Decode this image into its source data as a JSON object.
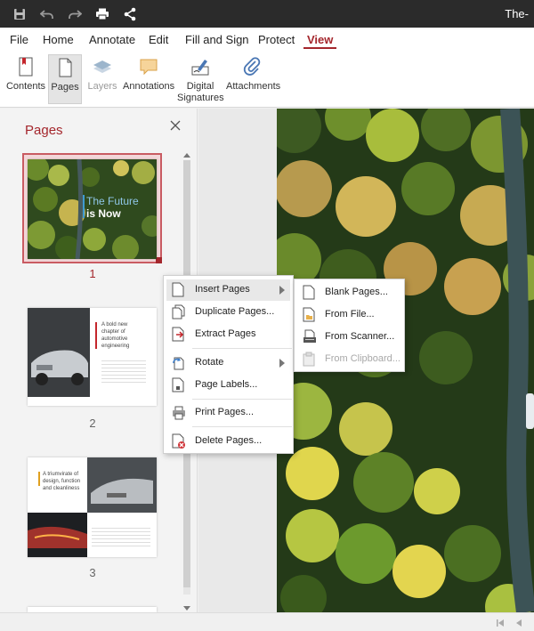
{
  "titlebar": {
    "doc_title": "The-",
    "quick_access": [
      "save-icon",
      "undo-icon",
      "redo-icon",
      "print-icon",
      "share-icon"
    ]
  },
  "menu": {
    "items": [
      "File",
      "Home",
      "Annotate",
      "Edit",
      "Fill and Sign",
      "Protect",
      "View"
    ],
    "active": "View"
  },
  "ribbon": {
    "contents": "Contents",
    "pages": "Pages",
    "layers": "Layers",
    "annotations": "Annotations",
    "signatures_line1": "Digital",
    "signatures_line2": "Signatures",
    "attachments": "Attachments"
  },
  "pane": {
    "title": "Pages",
    "page_numbers": [
      "1",
      "2",
      "3"
    ],
    "thumb1": {
      "line1": "The Future",
      "line2": "is Now"
    },
    "thumb2": {
      "line1": "A bold new",
      "line2": "chapter of",
      "line3": "automotive",
      "line4": "engineering"
    },
    "thumb3": {
      "line1": "A triumvirate of",
      "line2": "design, function",
      "line3": "and cleanliness"
    }
  },
  "context_menu": {
    "insert_pages": "Insert Pages",
    "duplicate_pages": "Duplicate Pages...",
    "extract_pages": "Extract Pages",
    "rotate": "Rotate",
    "page_labels": "Page Labels...",
    "print_pages": "Print Pages...",
    "delete_pages": "Delete Pages..."
  },
  "submenu": {
    "blank_pages": "Blank Pages...",
    "from_file": "From File...",
    "from_scanner": "From Scanner...",
    "from_clipboard": "From Clipboard..."
  },
  "colors": {
    "accent": "#a4262c",
    "titlebar": "#2b2b2b"
  }
}
